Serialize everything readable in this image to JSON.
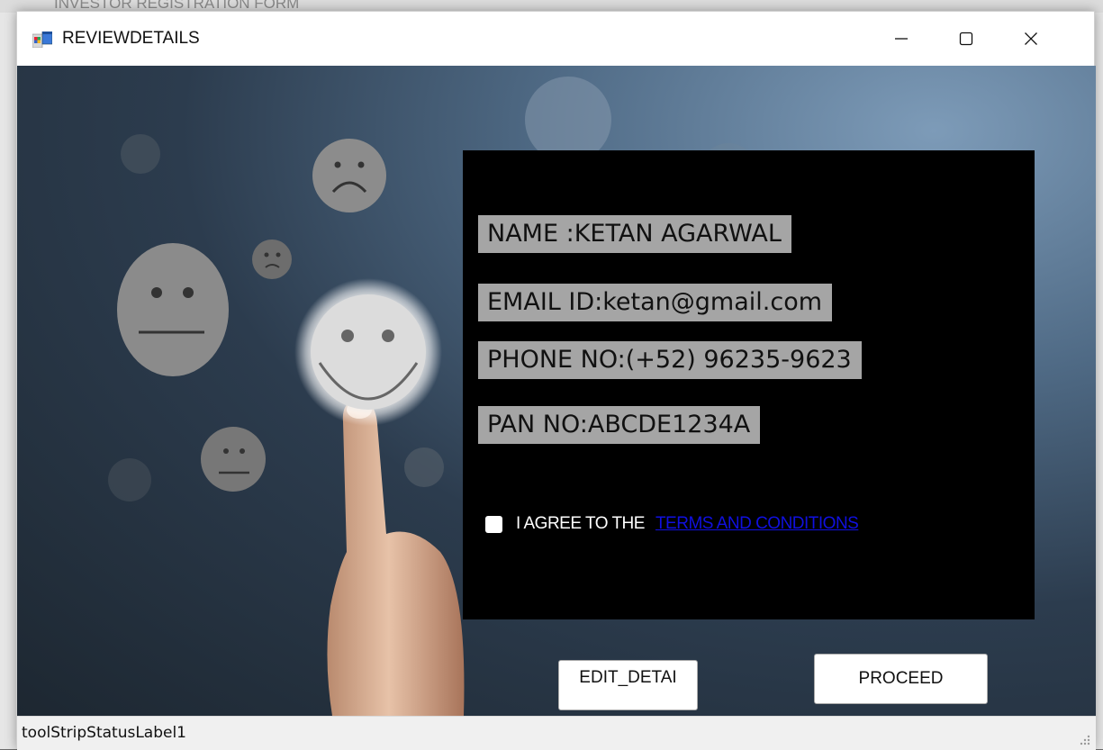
{
  "window": {
    "title": "REVIEWDETAILS",
    "background_title": "INVESTOR REGISTRATION FORM"
  },
  "fields": {
    "name": "NAME :KETAN AGARWAL",
    "email": "EMAIL ID:ketan@gmail.com",
    "phone": "PHONE NO:(+52) 96235-9623",
    "pan": "PAN NO:ABCDE1234A"
  },
  "agreement": {
    "label": "I AGREE TO THE",
    "link": "TERMS AND CONDITIONS",
    "checked": false
  },
  "buttons": {
    "edit": "EDIT_DETAI",
    "proceed": "PROCEED"
  },
  "status": {
    "label": "toolStripStatusLabel1"
  },
  "colors": {
    "panel": "#000000",
    "field_bg": "#a5a5a5",
    "link": "#1010e0"
  }
}
